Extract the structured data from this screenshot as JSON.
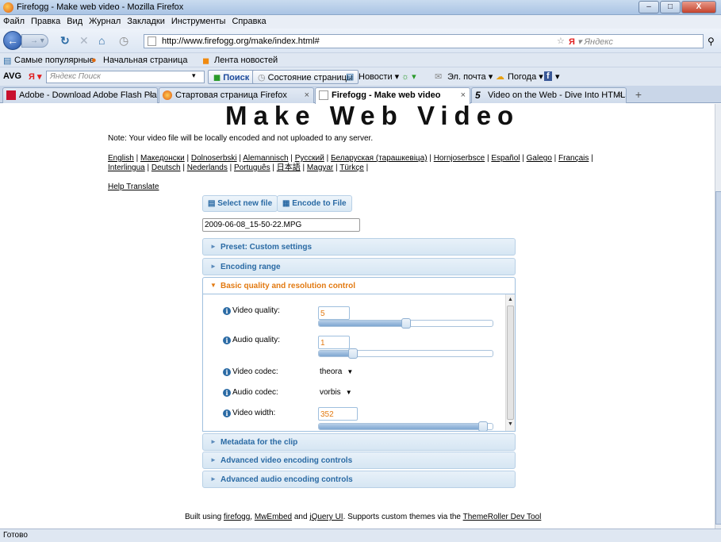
{
  "window": {
    "title": "Firefogg - Make web video - Mozilla Firefox",
    "minimize": "–",
    "maximize": "□",
    "close": "X"
  },
  "menu": [
    "Файл",
    "Правка",
    "Вид",
    "Журнал",
    "Закладки",
    "Инструменты",
    "Справка"
  ],
  "nav": {
    "url": "http://www.firefogg.org/make/index.html#",
    "search_placeholder": "Яндекс",
    "search_engine": "Я"
  },
  "bookmarks": {
    "popular": "Самые популярные",
    "start": "Начальная страница",
    "news": "Лента новостей"
  },
  "avg": {
    "brand": "AVG",
    "search_placeholder": "Яндекс Поиск",
    "search_button": "Поиск",
    "page_state": "Состояние страницы",
    "news": "Новости",
    "mail": "Эл. почта",
    "weather": "Погода"
  },
  "tabs": [
    {
      "title": "Adobe - Download Adobe Flash Pla...",
      "active": false
    },
    {
      "title": "Стартовая страница Firefox",
      "active": false
    },
    {
      "title": "Firefogg - Make web video",
      "active": true
    },
    {
      "title": "Video on the Web - Dive Into HTML5",
      "active": false
    }
  ],
  "page": {
    "title": "Make Web Video",
    "note": "Note: Your video file will be locally encoded and not uploaded to any server.",
    "languages_line1": [
      "English",
      "Македонски",
      "Dolnoserbski",
      "Alemannisch",
      "Русский",
      "Беларуская (тарашкевіца)",
      "Hornjoserbsce",
      "Español",
      "Galego",
      "Français"
    ],
    "languages_line2": [
      "Interlingua",
      "Deutsch",
      "Nederlands",
      "Português",
      "日本語",
      "Magyar",
      "Türkçe"
    ],
    "help_translate": "Help Translate",
    "select_file": "Select new file",
    "encode_file": "Encode to File",
    "filename": "2009-06-08_15-50-22.MPG",
    "sections": {
      "preset": "Preset: Custom settings",
      "range": "Encoding range",
      "basic": "Basic quality and resolution control",
      "metadata": "Metadata for the clip",
      "adv_video": "Advanced video encoding controls",
      "adv_audio": "Advanced audio encoding controls"
    },
    "options": {
      "video_quality": {
        "label": "Video quality:",
        "value": "5",
        "slider_fraction": 0.5
      },
      "audio_quality": {
        "label": "Audio quality:",
        "value": "1",
        "slider_fraction": 0.18
      },
      "video_codec": {
        "label": "Video codec:",
        "value": "theora"
      },
      "audio_codec": {
        "label": "Audio codec:",
        "value": "vorbis"
      },
      "video_width": {
        "label": "Video width:",
        "value": "352",
        "slider_fraction": 0.97
      }
    },
    "footer": {
      "prefix": "Built using",
      "firefogg": "firefogg",
      "mwembed": "MwEmbed",
      "and": "and",
      "jquery": "jQuery UI",
      "middle": ". Supports custom themes via the",
      "themeroller": "ThemeRoller Dev Tool"
    }
  },
  "status": "Готово"
}
